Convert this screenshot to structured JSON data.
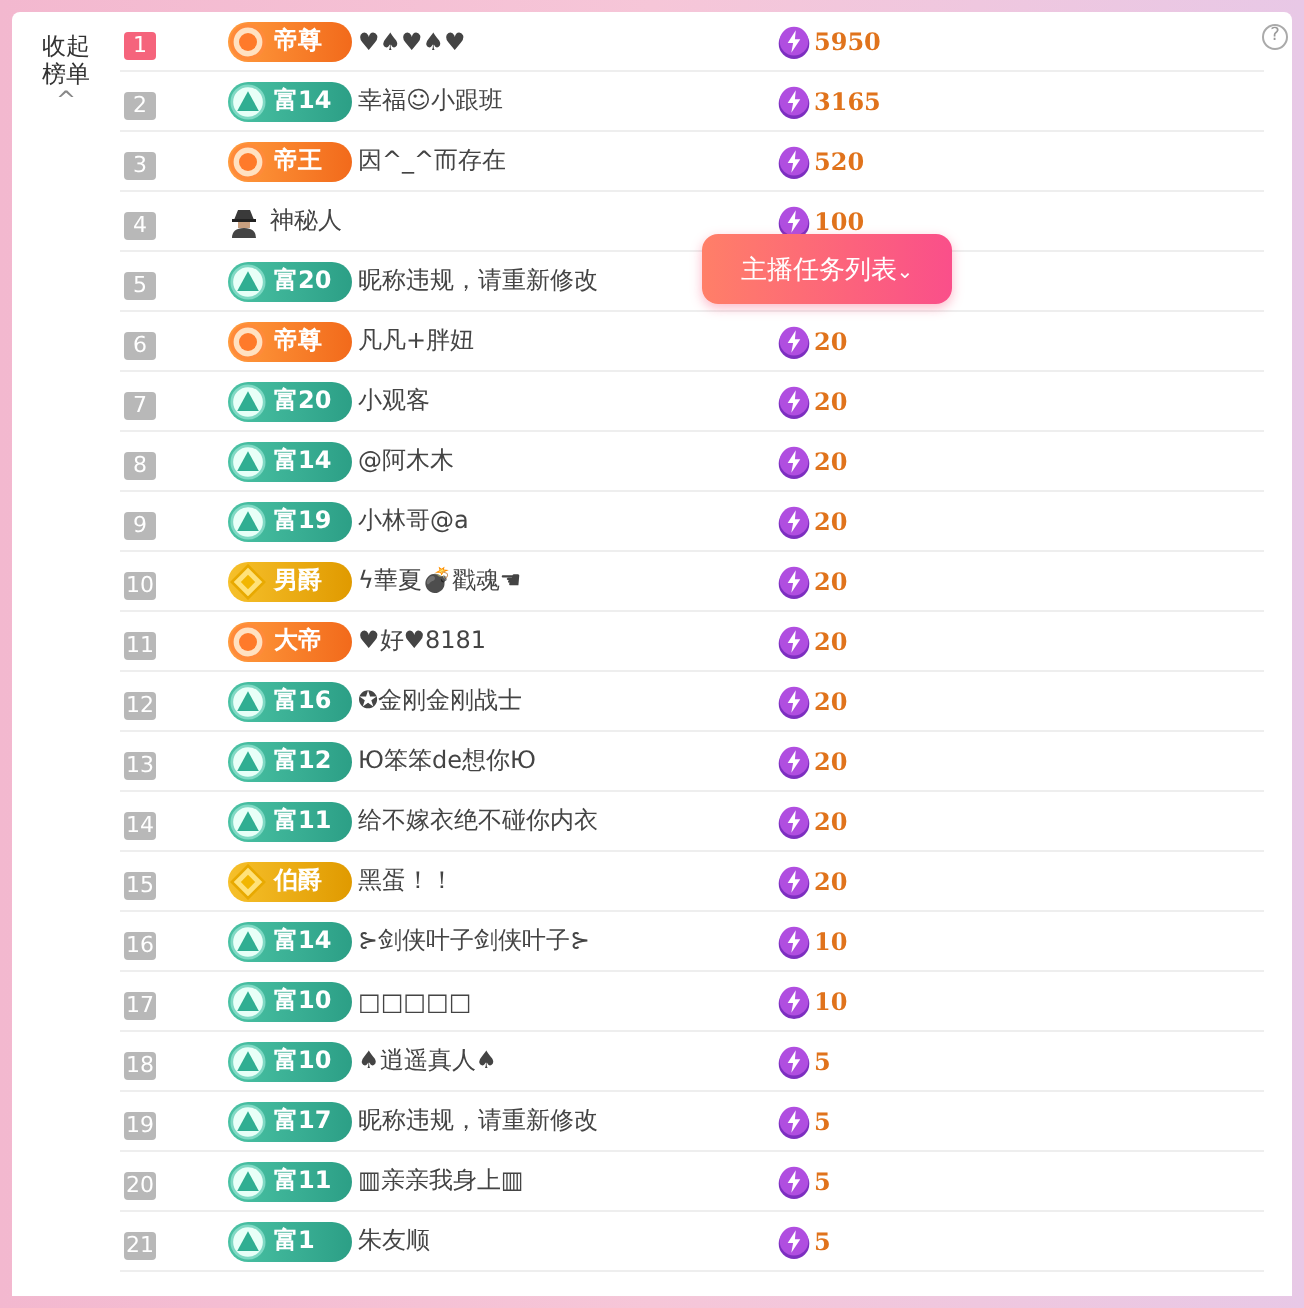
{
  "sidebar": {
    "collapse_label": "收起榜单",
    "collapse_icon": "^"
  },
  "rows": [
    {
      "rank": "1",
      "top": true,
      "badge": {
        "kind": "emperor",
        "label": "帝尊"
      },
      "name": "♥♠♥♠♥",
      "value": "5950"
    },
    {
      "rank": "2",
      "top": false,
      "badge": {
        "kind": "rich",
        "label": "富14"
      },
      "name": "幸福☺小跟班",
      "value": "3165"
    },
    {
      "rank": "3",
      "top": false,
      "badge": {
        "kind": "emperor",
        "label": "帝王"
      },
      "name": "因^_^而存在",
      "value": "520"
    },
    {
      "rank": "4",
      "top": false,
      "badge": {
        "kind": "mystery"
      },
      "name": "神秘人",
      "value": "100"
    },
    {
      "rank": "5",
      "top": false,
      "badge": {
        "kind": "rich",
        "label": "富20"
      },
      "name": "昵称违规，请重新修改"
    },
    {
      "rank": "6",
      "top": false,
      "badge": {
        "kind": "emperor",
        "label": "帝尊"
      },
      "name": "凡凡+胖妞",
      "value": "20"
    },
    {
      "rank": "7",
      "top": false,
      "badge": {
        "kind": "rich",
        "label": "富20"
      },
      "name": "小观客",
      "value": "20"
    },
    {
      "rank": "8",
      "top": false,
      "badge": {
        "kind": "rich",
        "label": "富14"
      },
      "name": "@阿木木",
      "value": "20"
    },
    {
      "rank": "9",
      "top": false,
      "badge": {
        "kind": "rich",
        "label": "富19"
      },
      "name": "小林哥@a",
      "value": "20"
    },
    {
      "rank": "10",
      "top": false,
      "badge": {
        "kind": "noble",
        "label": "男爵"
      },
      "name": "ϟ華夏💣戳魂☚",
      "value": "20"
    },
    {
      "rank": "11",
      "top": false,
      "badge": {
        "kind": "emperor",
        "label": "大帝"
      },
      "name": "♥好♥8181",
      "value": "20"
    },
    {
      "rank": "12",
      "top": false,
      "badge": {
        "kind": "rich",
        "label": "富16"
      },
      "name": "✪金刚金刚战士",
      "value": "20"
    },
    {
      "rank": "13",
      "top": false,
      "badge": {
        "kind": "rich",
        "label": "富12"
      },
      "name": "Ю笨笨de想你Ю",
      "value": "20"
    },
    {
      "rank": "14",
      "top": false,
      "badge": {
        "kind": "rich",
        "label": "富11"
      },
      "name": "给不嫁衣绝不碰你内衣",
      "value": "20"
    },
    {
      "rank": "15",
      "top": false,
      "badge": {
        "kind": "noble",
        "label": "伯爵"
      },
      "name": "黑蛋！！",
      "value": "20"
    },
    {
      "rank": "16",
      "top": false,
      "badge": {
        "kind": "rich",
        "label": "富14"
      },
      "name": "⊱剑侠叶子剑侠叶子⊱",
      "value": "10"
    },
    {
      "rank": "17",
      "top": false,
      "badge": {
        "kind": "rich",
        "label": "富10"
      },
      "name": "□□□□□",
      "value": "10"
    },
    {
      "rank": "18",
      "top": false,
      "badge": {
        "kind": "rich",
        "label": "富10"
      },
      "name": "♠逍遥真人♠",
      "value": "5"
    },
    {
      "rank": "19",
      "top": false,
      "badge": {
        "kind": "rich",
        "label": "富17"
      },
      "name": "昵称违规，请重新修改",
      "value": "5"
    },
    {
      "rank": "20",
      "top": false,
      "badge": {
        "kind": "rich",
        "label": "富11"
      },
      "name": "▥亲亲我身上▥",
      "value": "5"
    },
    {
      "rank": "21",
      "top": false,
      "badge": {
        "kind": "rich",
        "label": "富1"
      },
      "name": "朱友顺",
      "value": "5"
    }
  ],
  "help_icon": "?",
  "task_button": {
    "label": "主播任务列表",
    "caret": "⌄"
  }
}
